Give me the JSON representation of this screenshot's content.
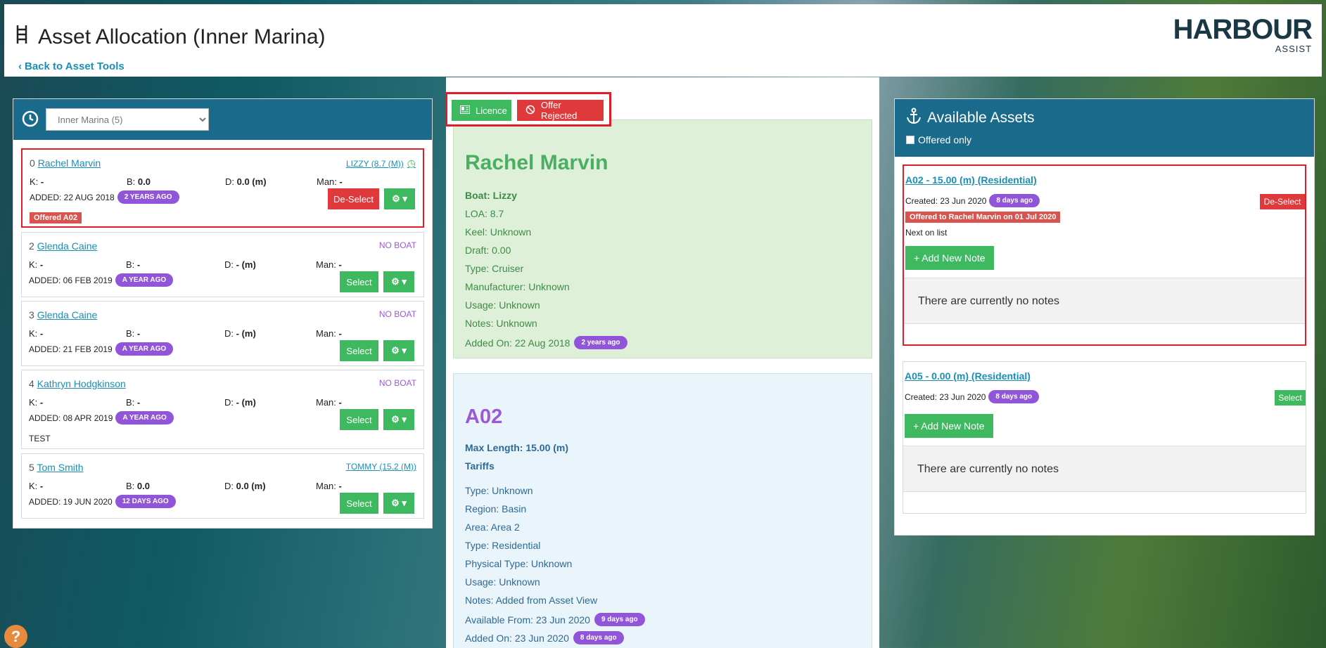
{
  "header": {
    "title": "Asset Allocation (Inner Marina)",
    "back_label": "Back to Asset Tools",
    "logo_main": "HARBOUR",
    "logo_sub": "ASSIST"
  },
  "left": {
    "filter_selected": "Inner Marina (5)",
    "people": [
      {
        "index": "0",
        "name": "Rachel Marvin",
        "boat": "LIZZY (8.7 (M))",
        "k": "-",
        "b": "0.0",
        "d": "0.0 (m)",
        "man": "-",
        "added": "ADDED: 22 AUG 2018",
        "age": "2 YEARS AGO",
        "action": "De-Select",
        "tag": "Offered A02",
        "note": ""
      },
      {
        "index": "2",
        "name": "Glenda Caine",
        "boat": "NO BOAT",
        "k": "-",
        "b": "-",
        "d": "- (m)",
        "man": "-",
        "added": "ADDED: 06 FEB 2019",
        "age": "A YEAR AGO",
        "action": "Select",
        "tag": "",
        "note": ""
      },
      {
        "index": "3",
        "name": "Glenda Caine",
        "boat": "NO BOAT",
        "k": "-",
        "b": "-",
        "d": "- (m)",
        "man": "-",
        "added": "ADDED: 21 FEB 2019",
        "age": "A YEAR AGO",
        "action": "Select",
        "tag": "",
        "note": ""
      },
      {
        "index": "4",
        "name": "Kathryn Hodgkinson",
        "boat": "NO BOAT",
        "k": "-",
        "b": "-",
        "d": "- (m)",
        "man": "-",
        "added": "ADDED: 08 APR 2019",
        "age": "A YEAR AGO",
        "action": "Select",
        "tag": "",
        "note": "TEST"
      },
      {
        "index": "5",
        "name": "Tom Smith",
        "boat": "TOMMY (15.2 (M))",
        "k": "-",
        "b": "0.0",
        "d": "0.0 (m)",
        "man": "-",
        "added": "ADDED: 19 JUN 2020",
        "age": "12 DAYS AGO",
        "action": "Select",
        "tag": "",
        "note": ""
      }
    ],
    "labels": {
      "k": "K:",
      "b": "B:",
      "d": "D:",
      "man": "Man:"
    }
  },
  "toolbar": {
    "licence": "Licence",
    "offer_rejected": "Offer Rejected"
  },
  "person_detail": {
    "name": "Rachel Marvin",
    "boat": "Boat: Lizzy",
    "loa": "LOA: 8.7",
    "keel": "Keel: Unknown",
    "draft": "Draft: 0.00",
    "type": "Type: Cruiser",
    "manufacturer": "Manufacturer: Unknown",
    "usage": "Usage: Unknown",
    "notes": "Notes: Unknown",
    "added_on": "Added On: 22 Aug 2018",
    "added_age": "2 years ago"
  },
  "asset_detail": {
    "name": "A02",
    "max_length": "Max Length: 15.00 (m)",
    "tariffs": "Tariffs",
    "type": "Type: Unknown",
    "region": "Region: Basin",
    "area": "Area: Area 2",
    "type2": "Type: Residential",
    "physical_type": "Physical Type: Unknown",
    "usage": "Usage: Unknown",
    "notes": "Notes: Added from Asset View",
    "available_from": "Available From: 23 Jun 2020",
    "available_age": "9 days ago",
    "added_on": "Added On: 23 Jun 2020",
    "added_age": "8 days ago"
  },
  "available": {
    "title": "Available Assets",
    "offered_only": "Offered only",
    "assets": [
      {
        "title": "A02 - 15.00 (m) (Residential)",
        "created": "Created: 23 Jun 2020",
        "age": "8 days ago",
        "action": "De-Select",
        "offer": "Offered to Rachel Marvin on 01 Jul 2020",
        "next": "Next on list",
        "add_note": "+ Add New Note",
        "notes": "There are currently no notes"
      },
      {
        "title": "A05 - 0.00 (m) (Residential)",
        "created": "Created: 23 Jun 2020",
        "age": "8 days ago",
        "action": "Select",
        "offer": "",
        "next": "",
        "add_note": "+ Add New Note",
        "notes": "There are currently no notes"
      }
    ]
  },
  "help_label": "?"
}
